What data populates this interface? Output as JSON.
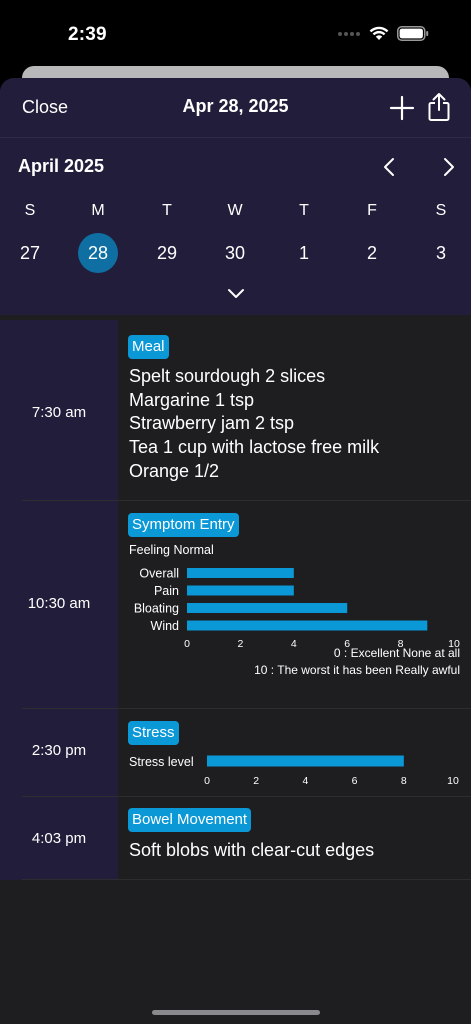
{
  "status_bar": {
    "time": "2:39"
  },
  "nav": {
    "close_label": "Close",
    "title": "Apr 28, 2025"
  },
  "calendar": {
    "month_title": "April 2025",
    "weekdays": [
      "S",
      "M",
      "T",
      "W",
      "T",
      "F",
      "S"
    ],
    "days": [
      "27",
      "28",
      "29",
      "30",
      "1",
      "2",
      "3"
    ],
    "selected_index": 1
  },
  "colors": {
    "accent": "#0b98d6",
    "selected_day": "#0f6fa3",
    "panel": "#221d3a",
    "background": "#1e1e20"
  },
  "entries": {
    "meal": {
      "time": "7:30 am",
      "tag": "Meal",
      "lines": [
        "Spelt sourdough 2 slices",
        "Margarine 1 tsp",
        "Strawberry jam 2 tsp",
        "Tea 1 cup with lactose free milk",
        "Orange 1/2"
      ]
    },
    "symptom": {
      "time": "10:30 am",
      "tag": "Symptom Entry",
      "feeling": "Feeling Normal",
      "legend_low": "0 : Excellent None at all",
      "legend_high": "10 : The worst it has been Really awful"
    },
    "stress": {
      "time": "2:30 pm",
      "tag": "Stress",
      "label": "Stress level"
    },
    "bowel": {
      "time": "4:03 pm",
      "tag": "Bowel Movement",
      "description": "Soft blobs with clear-cut edges"
    }
  },
  "chart_data": [
    {
      "type": "bar",
      "orientation": "horizontal",
      "categories": [
        "Overall",
        "Pain",
        "Bloating",
        "Wind"
      ],
      "values": [
        4,
        4,
        6,
        9
      ],
      "xlim": [
        0,
        10
      ],
      "xticks": [
        "0",
        "2",
        "4",
        "6",
        "8",
        "10"
      ],
      "grid": false
    },
    {
      "type": "bar",
      "orientation": "horizontal",
      "categories": [
        "Stress level"
      ],
      "values": [
        8
      ],
      "xlim": [
        0,
        10
      ],
      "xticks": [
        "0",
        "2",
        "4",
        "6",
        "8",
        "10"
      ],
      "grid": false
    }
  ]
}
